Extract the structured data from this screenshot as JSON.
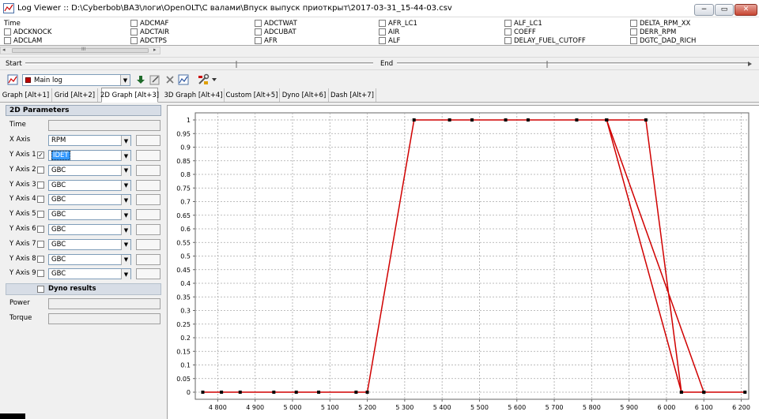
{
  "window": {
    "title": "Log Viewer :: D:\\Cyberbob\\ВАЗ\\логи\\OpenOLT\\С валами\\Впуск выпуск приоткрыт\\2017-03-31_15-44-03.csv",
    "minimize_glyph": "−",
    "maximize_glyph": "▭",
    "close_glyph": "✕"
  },
  "params": {
    "columns": [
      [
        "Time",
        "ADCKNOCK",
        "ADCLAM"
      ],
      [
        "ADCMAF",
        "ADCTAIR",
        "ADCTPS"
      ],
      [
        "ADCTWAT",
        "ADCUBAT",
        "AFR"
      ],
      [
        "AFR_LC1",
        "AIR",
        "ALF"
      ],
      [
        "ALF_LC1",
        "COEFF",
        "DELAY_FUEL_CUTOFF"
      ],
      [
        "DELTA_RPM_XX",
        "DERR_RPM",
        "DGTC_DAD_RICH"
      ]
    ],
    "scroll_grip": "III",
    "scroll_left": "◂",
    "scroll_right": "▸"
  },
  "range": {
    "start_label": "Start",
    "end_label": "End"
  },
  "toolbar": {
    "log_name": "Main log",
    "icons": [
      "chart-icon",
      "save-down-icon",
      "edit-icon",
      "delete-icon",
      "chart-add-icon",
      "tools-icon",
      "dropdown-arrow-icon"
    ]
  },
  "tabs": [
    {
      "label": "Graph [Alt+1]",
      "active": false
    },
    {
      "label": "Grid [Alt+2]",
      "active": false
    },
    {
      "label": "2D Graph [Alt+3]",
      "active": true
    },
    {
      "label": "3D Graph [Alt+4]",
      "active": false
    },
    {
      "label": "Custom [Alt+5]",
      "active": false
    },
    {
      "label": "Dyno [Alt+6]",
      "active": false
    },
    {
      "label": "Dash [Alt+7]",
      "active": false
    }
  ],
  "panel": {
    "title": "2D Parameters",
    "time_label": "Time",
    "x_axis_label": "X Axis",
    "x_axis_value": "RPM",
    "y_axes": [
      {
        "label": "Y Axis 1",
        "checked": true,
        "value": "IDET",
        "selected": true
      },
      {
        "label": "Y Axis 2",
        "checked": false,
        "value": "GBC",
        "selected": false
      },
      {
        "label": "Y Axis 3",
        "checked": false,
        "value": "GBC",
        "selected": false
      },
      {
        "label": "Y Axis 4",
        "checked": false,
        "value": "GBC",
        "selected": false
      },
      {
        "label": "Y Axis 5",
        "checked": false,
        "value": "GBC",
        "selected": false
      },
      {
        "label": "Y Axis 6",
        "checked": false,
        "value": "GBC",
        "selected": false
      },
      {
        "label": "Y Axis 7",
        "checked": false,
        "value": "GBC",
        "selected": false
      },
      {
        "label": "Y Axis 8",
        "checked": false,
        "value": "GBC",
        "selected": false
      },
      {
        "label": "Y Axis 9",
        "checked": false,
        "value": "GBC",
        "selected": false
      }
    ],
    "check_glyph": "✓",
    "dropdown_glyph": "▼",
    "dyno_label": "Dyno results",
    "power_label": "Power",
    "torque_label": "Torque"
  },
  "chart_data": {
    "type": "line",
    "title": "",
    "xlabel": "",
    "ylabel": "",
    "xlim": [
      4740,
      6220
    ],
    "ylim": [
      0,
      1
    ],
    "x_ticks": [
      4800,
      4900,
      5000,
      5100,
      5200,
      5300,
      5400,
      5500,
      5600,
      5700,
      5800,
      5900,
      6000,
      6100,
      6200
    ],
    "x_tick_labels": [
      "4 800",
      "4 900",
      "5 000",
      "5 100",
      "5 200",
      "5 300",
      "5 400",
      "5 500",
      "5 600",
      "5 700",
      "5 800",
      "5 900",
      "6 000",
      "6 100",
      "6 200"
    ],
    "y_ticks": [
      0,
      0.05,
      0.1,
      0.15,
      0.2,
      0.25,
      0.3,
      0.35,
      0.4,
      0.45,
      0.5,
      0.55,
      0.6,
      0.65,
      0.7,
      0.75,
      0.8,
      0.85,
      0.9,
      0.95,
      1
    ],
    "y_tick_labels": [
      "0",
      "0.05",
      "0.1",
      "0.15",
      "0.2",
      "0.25",
      "0.3",
      "0.35",
      "0.4",
      "0.45",
      "0.5",
      "0.55",
      "0.6",
      "0.65",
      "0.7",
      "0.75",
      "0.8",
      "0.85",
      "0.9",
      "0.95",
      "1"
    ],
    "grid": true,
    "line_color": "#d00000",
    "marker_color": "#000000",
    "series": [
      {
        "x": [
          4760,
          4810,
          4860,
          4950,
          5010,
          5070,
          5170,
          5200,
          5325,
          5420,
          5480,
          5570,
          5630,
          5760,
          5840,
          6040,
          5840,
          6100,
          5840,
          5945,
          6040,
          6100,
          6210
        ],
        "y": [
          0,
          0,
          0,
          0,
          0,
          0,
          0,
          0,
          1,
          1,
          1,
          1,
          1,
          1,
          1,
          0,
          1,
          0,
          1,
          1,
          0,
          0,
          0
        ]
      }
    ]
  }
}
